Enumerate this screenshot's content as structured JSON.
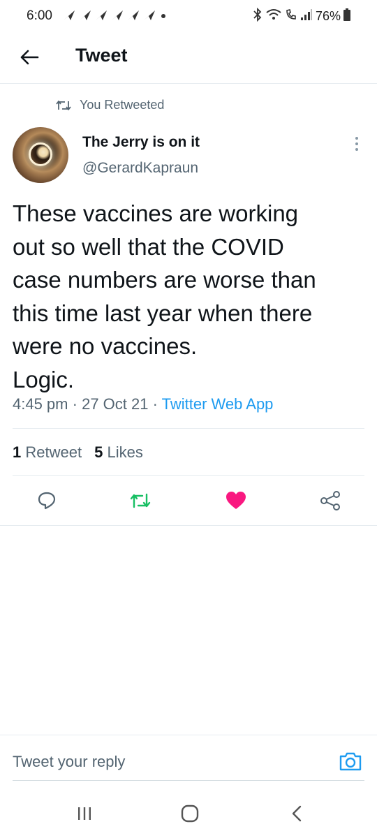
{
  "status_bar": {
    "time": "6:00",
    "battery": "76%",
    "notification_icons": [
      "navigation-arrow-icon",
      "navigation-arrow-icon",
      "navigation-arrow-icon",
      "navigation-arrow-icon",
      "navigation-arrow-icon",
      "navigation-arrow-icon"
    ]
  },
  "header": {
    "title": "Tweet"
  },
  "retweet_banner": {
    "text": "You Retweeted"
  },
  "tweet": {
    "author_name": "The Jerry is on it",
    "author_handle": "@GerardKapraun",
    "text_lines": [
      "These vaccines are working",
      "out so well that the COVID",
      "case numbers are worse than",
      "this time last year when there",
      "were no vaccines.",
      "Logic."
    ],
    "time": "4:45 pm",
    "date": "27 Oct 21",
    "source": "Twitter Web App",
    "retweet_count": "1",
    "retweet_label": "Retweet",
    "like_count": "5",
    "like_label": "Likes"
  },
  "actions": {
    "reply_icon": "comment-icon",
    "retweet_icon": "retweet-icon",
    "like_icon": "heart-icon",
    "share_icon": "share-icon",
    "retweet_color": "#17bf63",
    "like_color": "#f91880"
  },
  "reply": {
    "placeholder": "Tweet your reply"
  },
  "colors": {
    "accent": "#1d9bf0",
    "secondary_text": "#536471",
    "primary_text": "#0f1419"
  }
}
